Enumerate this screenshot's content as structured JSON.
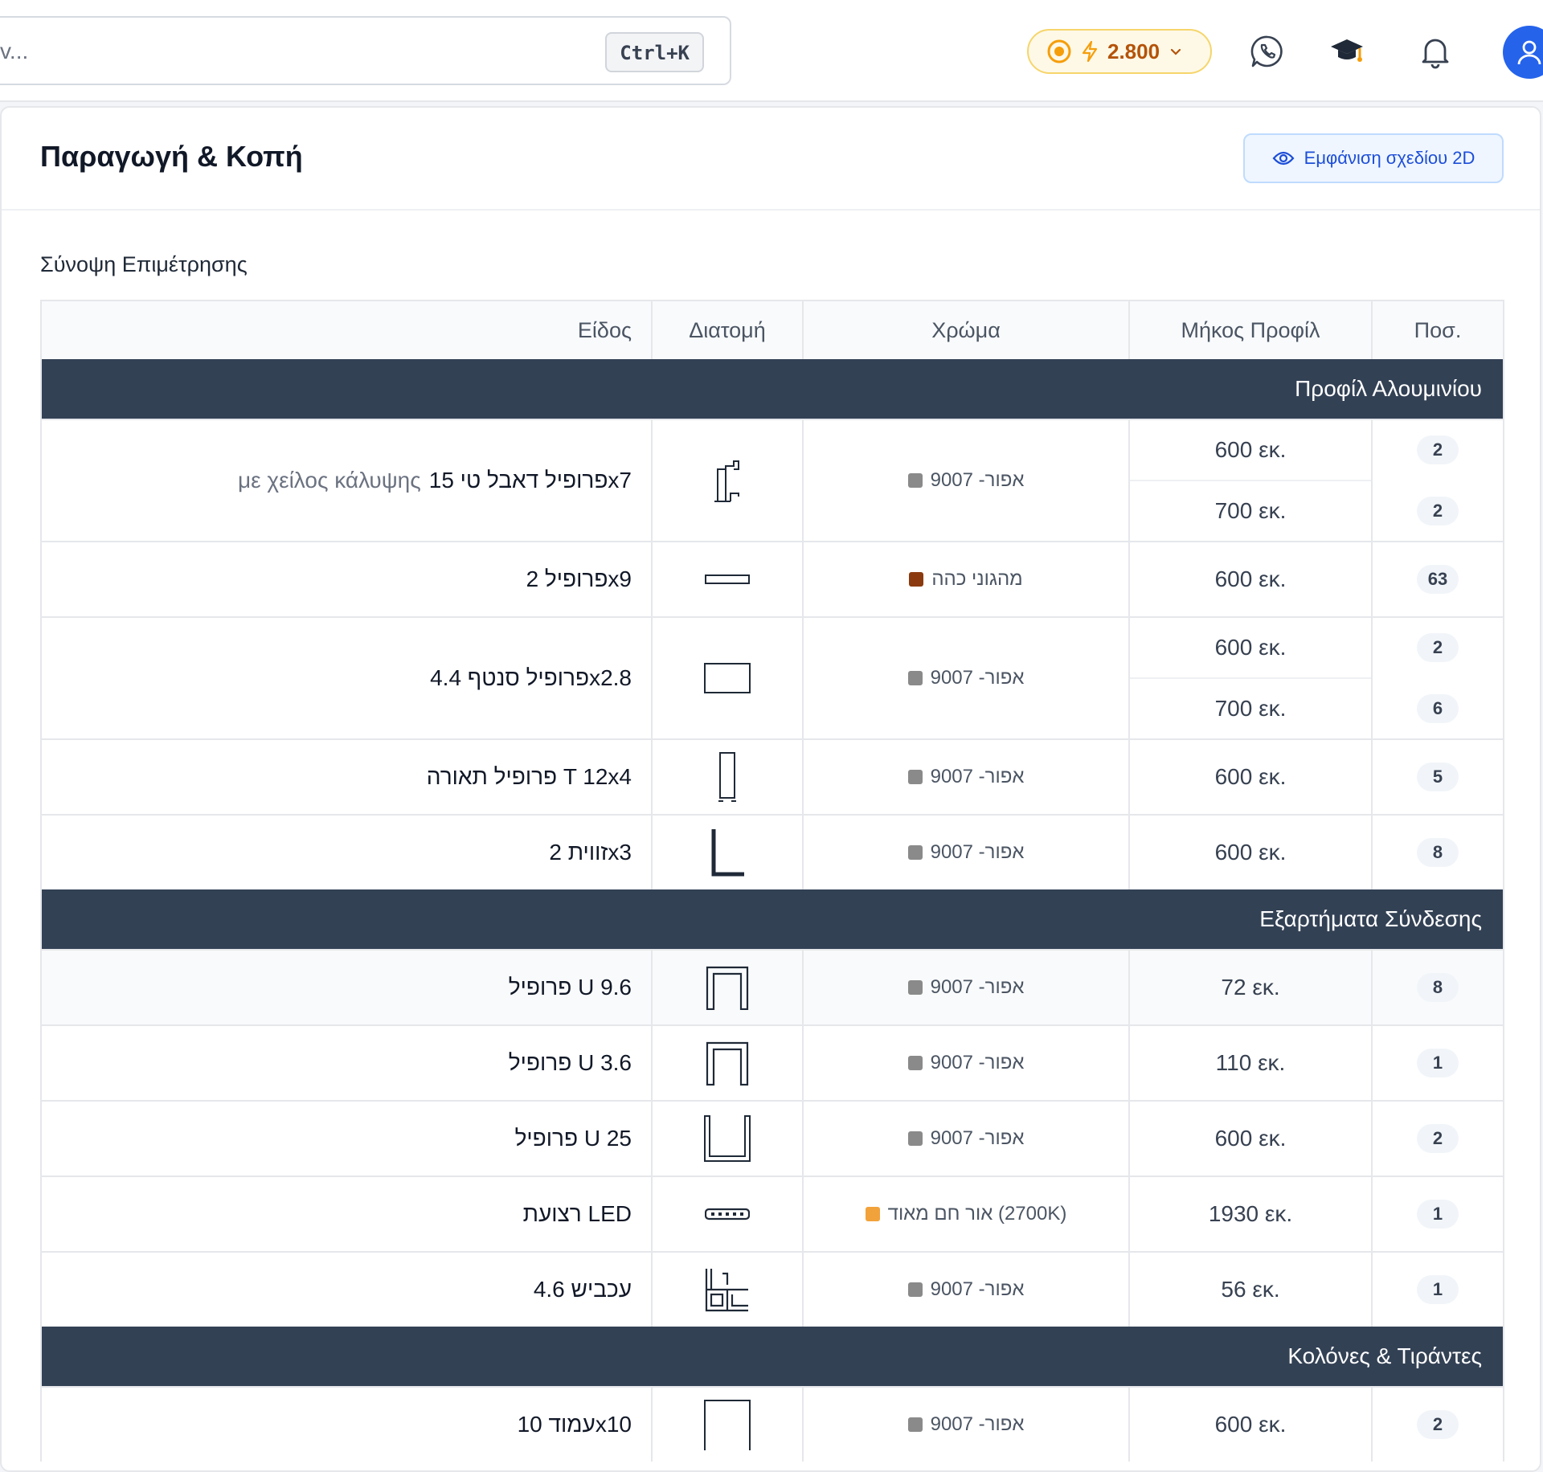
{
  "topbar": {
    "search_placeholder": "v...",
    "shortcut": "Ctrl+K",
    "credits": "2.800"
  },
  "page": {
    "title": "Παραγωγή & Κοπή",
    "view_2d_button": "Εμφάνιση σχεδίου 2D",
    "section_title": "Σύνοψη Επιμέτρησης"
  },
  "table": {
    "headers": {
      "item": "Είδος",
      "section": "Διατομή",
      "color": "Χρώμα",
      "length": "Μήκος Προφίλ",
      "qty": "Ποσ."
    },
    "groups": [
      {
        "title": "Προφίλ Αλουμινίου",
        "rows": [
          {
            "item": "פרופיל דאבל טי 15x7",
            "note": "με χείλος κάλυψης",
            "color": "אפור- 9007",
            "swatch": "#8a8a8a",
            "lengths": [
              "600 εκ.",
              "700 εκ."
            ],
            "qtys": [
              "2",
              "2"
            ],
            "icon": "double-t-profile-icon"
          },
          {
            "item": "פרופיל 2x9",
            "color": "מהגוני כהה",
            "swatch": "#8b3a0f",
            "lengths": [
              "600 εκ."
            ],
            "qtys": [
              "63"
            ],
            "icon": "flat-bar-icon"
          },
          {
            "item": "פרופיל סנטף 4.4x2.8",
            "color": "אפור- 9007",
            "swatch": "#8a8a8a",
            "lengths": [
              "600 εκ.",
              "700 εκ."
            ],
            "qtys": [
              "2",
              "6"
            ],
            "icon": "rectangle-profile-icon"
          },
          {
            "item": "פרופיל תאורה T 12x4",
            "color": "אפור- 9007",
            "swatch": "#8a8a8a",
            "lengths": [
              "600 εκ."
            ],
            "qtys": [
              "5"
            ],
            "icon": "t-light-profile-icon"
          },
          {
            "item": "זווית 2x3",
            "color": "אפור- 9007",
            "swatch": "#8a8a8a",
            "lengths": [
              "600 εκ."
            ],
            "qtys": [
              "8"
            ],
            "icon": "angle-profile-icon"
          }
        ]
      },
      {
        "title": "Εξαρτήματα Σύνδεσης",
        "rows": [
          {
            "item": "פרופיל U 9.6",
            "color": "אפור- 9007",
            "swatch": "#8a8a8a",
            "lengths": [
              "72 εκ."
            ],
            "qtys": [
              "8"
            ],
            "icon": "u-profile-icon",
            "highlight": true
          },
          {
            "item": "פרופיל U 3.6",
            "color": "אפור- 9007",
            "swatch": "#8a8a8a",
            "lengths": [
              "110 εκ."
            ],
            "qtys": [
              "1"
            ],
            "icon": "u-profile-icon"
          },
          {
            "item": "פרופיל U 25",
            "color": "אפור- 9007",
            "swatch": "#8a8a8a",
            "lengths": [
              "600 εκ."
            ],
            "qtys": [
              "2"
            ],
            "icon": "u-wide-profile-icon"
          },
          {
            "item": "רצועת LED",
            "color": "אור חם מאוד (2700K)",
            "swatch": "#f2a23a",
            "lengths": [
              "1930 εκ."
            ],
            "qtys": [
              "1"
            ],
            "icon": "led-strip-icon"
          },
          {
            "item": "עכביש 4.6",
            "color": "אפור- 9007",
            "swatch": "#8a8a8a",
            "lengths": [
              "56 εκ."
            ],
            "qtys": [
              "1"
            ],
            "icon": "spider-connector-icon"
          }
        ]
      },
      {
        "title": "Κολόνες & Τιράντες",
        "rows": [
          {
            "item": "עמוד 10x10",
            "color": "אפור- 9007",
            "swatch": "#8a8a8a",
            "lengths": [
              "600 εκ."
            ],
            "qtys": [
              "2"
            ],
            "icon": "square-post-icon"
          }
        ]
      }
    ]
  }
}
